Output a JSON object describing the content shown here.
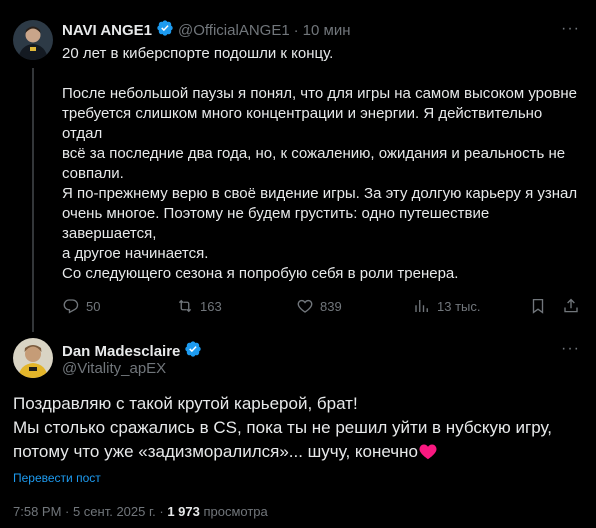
{
  "post1": {
    "display_name": "NAVI ANGE1",
    "handle": "@OfficialANGE1",
    "separator": "·",
    "time": "10 мин",
    "paragraphs": [
      "20 лет в киберспорте подошли к концу.",
      "После небольшой паузы я понял, что для игры на самом высоком уровне\nтребуется слишком много концентрации и энергии. Я действительно отдал\nвсё за последние два года, но, к сожалению, ожидания и реальность не\nсовпали.",
      "Я по-прежнему верю в своё видение игры. За эту долгую карьеру я узнал\nочень многое. Поэтому не будем грустить: одно путешествие завершается,\nа другое начинается.",
      "Со следующего сезона я попробую себя в роли тренера."
    ],
    "stats": {
      "replies": "50",
      "reposts": "163",
      "likes": "839",
      "views": "13 тыс."
    },
    "icons": [
      "reply-icon",
      "repost-icon",
      "like-icon",
      "views-icon",
      "bookmark-icon",
      "share-icon",
      "verified-icon",
      "more-icon"
    ]
  },
  "post2": {
    "display_name": "Dan Madesclaire",
    "handle": "@Vitality_apEX",
    "text": "Поздравляю с такой крутой карьерой, брат!\nМы столько сражались в CS, пока ты не решил уйти в нубскую игру,\nпотому что уже «задизморалился»... шучу, конечно",
    "emoji": "❤️",
    "translate_label": "Перевести пост",
    "timestamp": "7:58 PM · 5 сент. 2025 г. · ",
    "views_count": "1 973",
    "views_label": " просмотра"
  },
  "colors": {
    "background": "#000000",
    "text": "#e7e9ea",
    "secondary": "#71767b",
    "accent": "#1d9bf0",
    "heart": "#f91880",
    "divider": "#2f3336"
  }
}
